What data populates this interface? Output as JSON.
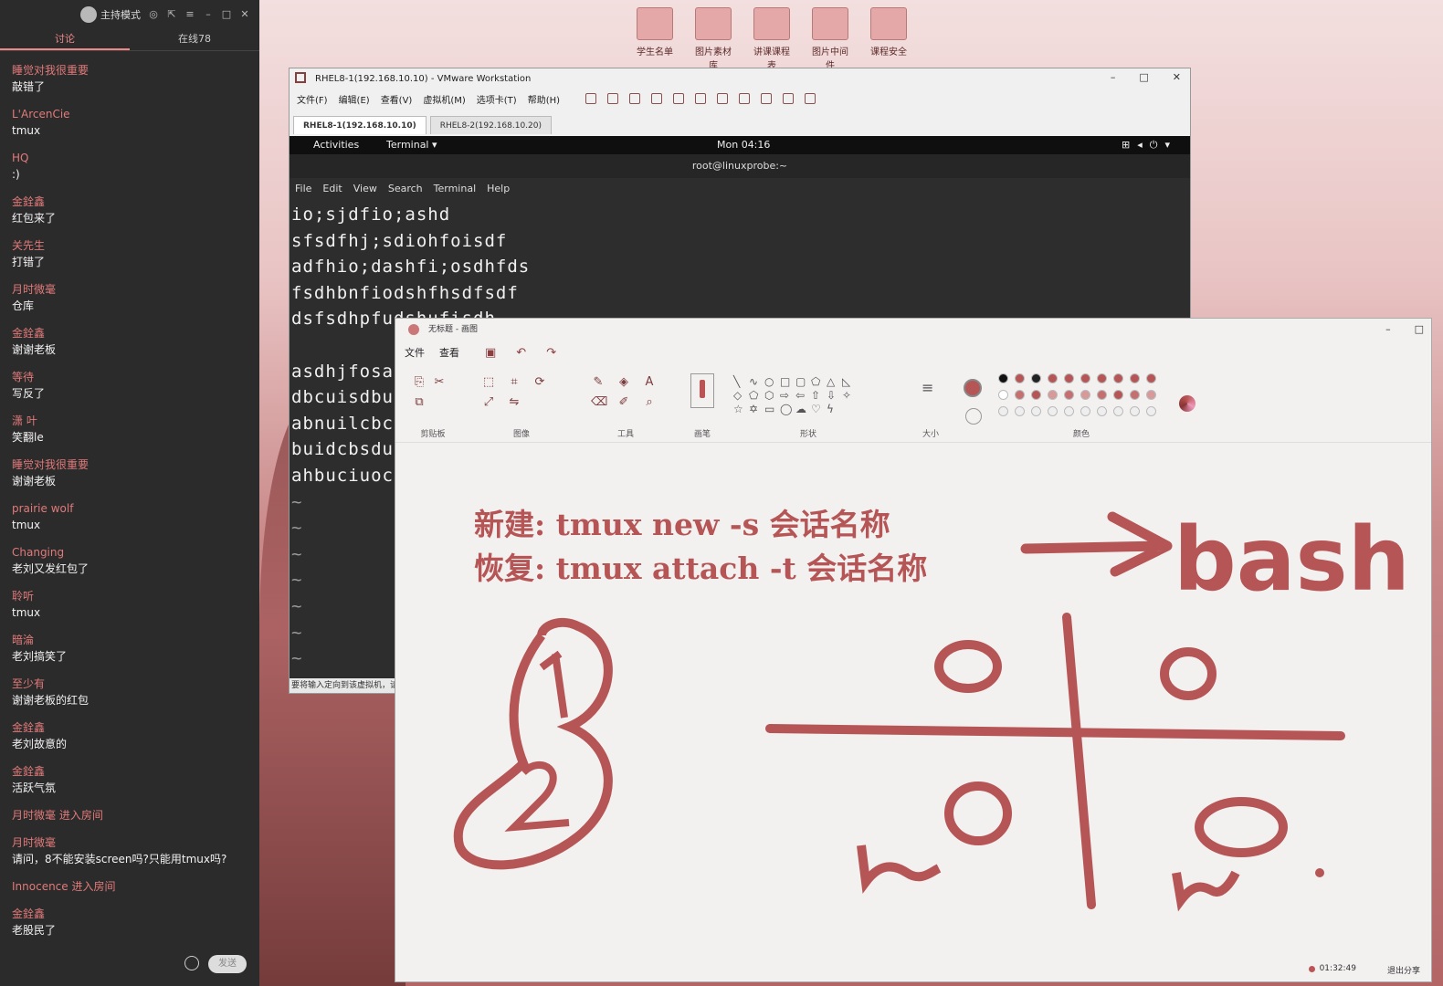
{
  "chat": {
    "mode": "主持模式",
    "tabs": [
      "讨论",
      "在线78"
    ],
    "messages": [
      {
        "name": "睡觉对我很重要",
        "text": "敲错了"
      },
      {
        "name": "L'ArcenCie",
        "text": "tmux"
      },
      {
        "name": "HQ",
        "text": ":)"
      },
      {
        "name": "金銓鑫",
        "text": "红包来了"
      },
      {
        "name": "关先生",
        "text": "打错了"
      },
      {
        "name": "月时微毫",
        "text": "仓库"
      },
      {
        "name": "金銓鑫",
        "text": "谢谢老板"
      },
      {
        "name": "等待",
        "text": "写反了"
      },
      {
        "name": "潇   叶",
        "text": "笑翻le"
      },
      {
        "name": "睡觉对我很重要",
        "text": "谢谢老板"
      },
      {
        "name": "prairie wolf",
        "text": "tmux"
      },
      {
        "name": "Changing",
        "text": "老刘又发红包了"
      },
      {
        "name": "聆听",
        "text": "tmux"
      },
      {
        "name": "暗淪",
        "text": "老刘搞笑了"
      },
      {
        "name": "至少有",
        "text": "谢谢老板的红包"
      },
      {
        "name": "金銓鑫",
        "text": "老刘故意的"
      },
      {
        "name": "金銓鑫",
        "text": "活跃气氛"
      },
      {
        "name": "月时微毫 进入房间",
        "text": ""
      },
      {
        "name": "月时微毫",
        "text": "请问，8不能安装screen吗?只能用tmux吗?"
      },
      {
        "name": "Innocence 进入房间",
        "text": ""
      },
      {
        "name": "金銓鑫",
        "text": "老股民了"
      }
    ],
    "send_label": "发送"
  },
  "desktop": {
    "icons": [
      "学生名单",
      "图片素材库",
      "讲课课程表",
      "图片中间件",
      "课程安全"
    ]
  },
  "vmware": {
    "title": "RHEL8-1(192.168.10.10) - VMware Workstation",
    "menu": [
      "文件(F)",
      "编辑(E)",
      "查看(V)",
      "虚拟机(M)",
      "选项卡(T)",
      "帮助(H)"
    ],
    "tabs": [
      "RHEL8-1(192.168.10.10)",
      "RHEL8-2(192.168.10.20)"
    ],
    "status": "要将输入定向到该虚拟机，请"
  },
  "gnome": {
    "activities": "Activities",
    "app_menu": "Terminal ▾",
    "clock": "Mon 04:16"
  },
  "terminal": {
    "title": "root@linuxprobe:~",
    "menu": [
      "File",
      "Edit",
      "View",
      "Search",
      "Terminal",
      "Help"
    ],
    "lines": [
      "io;sjdfio;ashd",
      "sfsdfhj;sdiohfoisdf",
      "adfhio;dashfi;osdhfds",
      "fsdhbnfiodshfhsdfsdf",
      "dsfsdhpfudshufisdh",
      "",
      "asdhjfosa",
      "dbcuisdbu",
      "abnuilcbc",
      "buidcbsdu",
      "ahbuciuoc",
      "~",
      "~",
      "~",
      "~",
      "~",
      "~",
      "~"
    ]
  },
  "paint": {
    "title": "无标题 - 画图",
    "tabs": [
      "文件",
      "查看"
    ],
    "groups": [
      "剪贴板",
      "图像",
      "工具",
      "画笔",
      "形状",
      "大小",
      "颜色"
    ],
    "canvas_text_1": "新建: tmux new -s 会话名称",
    "canvas_text_2": "恢复: tmux attach -t 会话名称",
    "handwriting": "bash",
    "timer": "01:32:49",
    "share": "退出分享",
    "accent_color": "#b55555"
  }
}
